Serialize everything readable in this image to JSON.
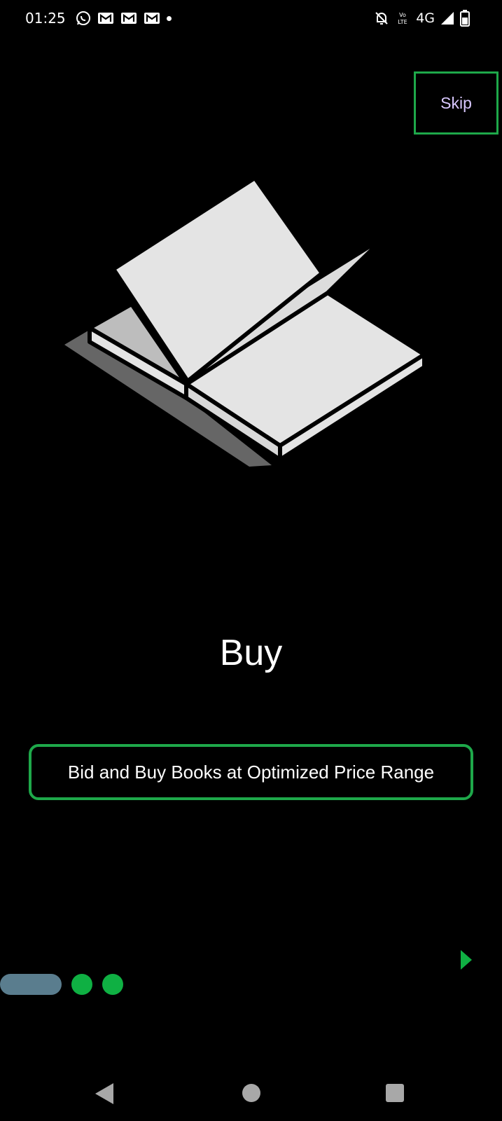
{
  "status_bar": {
    "time": "01:25",
    "network": "4G",
    "left_icons": [
      "whatsapp-icon",
      "gmail-icon",
      "gmail-icon",
      "gmail-icon",
      "notification-dot"
    ],
    "right_icons": [
      "notifications-off-icon",
      "volte-icon",
      "signal-icon",
      "battery-icon"
    ]
  },
  "onboarding": {
    "skip_label": "Skip",
    "title": "Buy",
    "description": "Bid and Buy Books at Optimized Price Range",
    "page_count": 3,
    "current_page": 1
  },
  "colors": {
    "background": "#000000",
    "accent_green": "#1ea84a",
    "dot_green": "#0fb043",
    "active_indicator": "#5a7d8e",
    "skip_text": "#d9c8ff"
  },
  "navigation": {
    "icons": [
      "back-icon",
      "home-icon",
      "recents-icon"
    ]
  }
}
